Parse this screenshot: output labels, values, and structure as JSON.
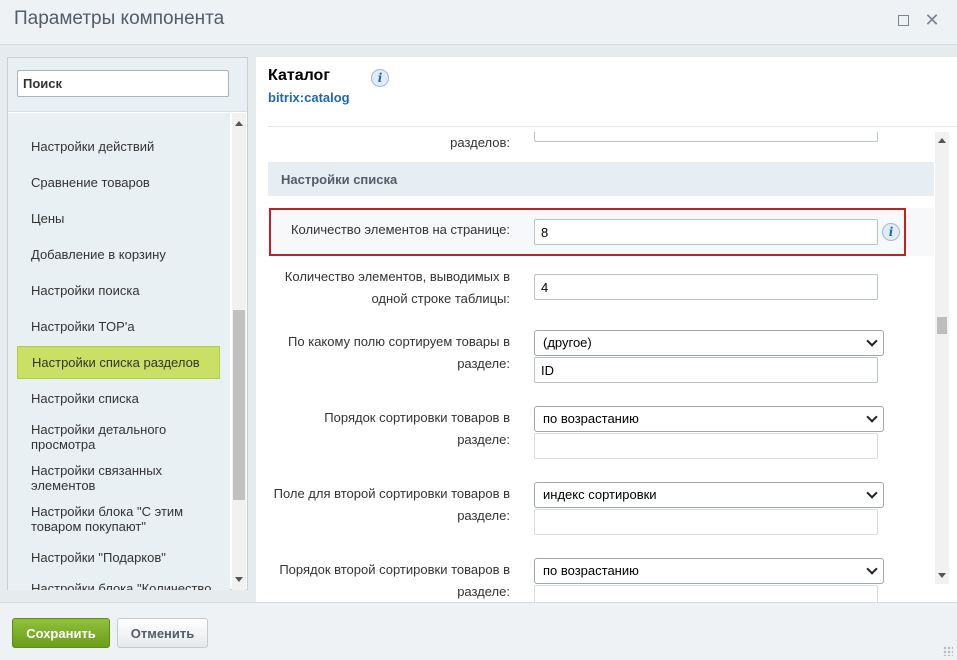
{
  "window": {
    "title": "Параметры компонента"
  },
  "sidebar": {
    "search_placeholder": "Поиск",
    "items": [
      {
        "label": "Настройки действий"
      },
      {
        "label": "Сравнение товаров"
      },
      {
        "label": "Цены"
      },
      {
        "label": "Добавление в корзину"
      },
      {
        "label": "Настройки поиска"
      },
      {
        "label": "Настройки TOP'а"
      },
      {
        "label": "Настройки списка разделов",
        "active": true
      },
      {
        "label": "Настройки списка"
      },
      {
        "label": "Настройки детального просмотра"
      },
      {
        "label": "Настройки связанных элементов"
      },
      {
        "label": "Настройки блока \"С этим товаром покупают\""
      },
      {
        "label": "Настройки \"Подарков\""
      },
      {
        "label": "Настройки блока \"Количество"
      }
    ]
  },
  "component": {
    "name": "Каталог",
    "code": "bitrix:catalog"
  },
  "form": {
    "cutoff_label": "разделов:",
    "section_title": "Настройки списка",
    "fields": [
      {
        "label": "Количество элементов на странице:",
        "value": "8"
      },
      {
        "label": "Количество элементов, выводимых в одной строке таблицы:",
        "value": "4"
      },
      {
        "label": "По какому полю сортируем товары в разделе:",
        "select": "(другое)",
        "value": "ID"
      },
      {
        "label": "Порядок сортировки товаров в разделе:",
        "select": "по возрастанию",
        "value": ""
      },
      {
        "label": "Поле для второй сортировки товаров в разделе:",
        "select": "индекс сортировки",
        "value": ""
      },
      {
        "label": "Порядок второй сортировки товаров в разделе:",
        "select": "по возрастанию",
        "value": ""
      }
    ]
  },
  "footer": {
    "save_label": "Сохранить",
    "cancel_label": "Отменить"
  },
  "colors": {
    "accent_green": "#8fc13b",
    "active_item": "#c9e064",
    "highlight_border": "#b5262b",
    "link_blue": "#2067b0"
  }
}
